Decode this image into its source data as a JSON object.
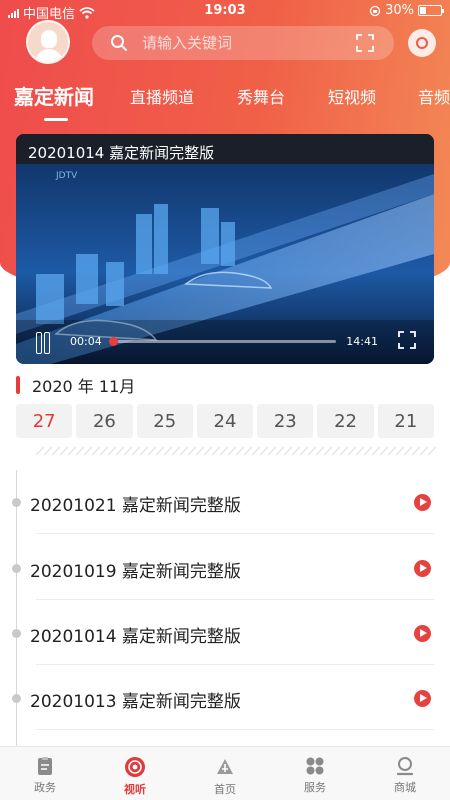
{
  "status_bar": {
    "carrier": "中国电信",
    "time": "19:03",
    "battery": "30%"
  },
  "search": {
    "placeholder": "请输入关键词"
  },
  "channel_tabs": [
    {
      "label": "嘉定新闻",
      "active": true
    },
    {
      "label": "直播频道"
    },
    {
      "label": "秀舞台"
    },
    {
      "label": "短视频"
    },
    {
      "label": "音频"
    }
  ],
  "player": {
    "title": "20201014 嘉定新闻完整版",
    "watermark": "JDTV",
    "current_time": "00:04",
    "duration": "14:41",
    "progress_fraction": 0.005
  },
  "date_header": "2020 年 11月",
  "days": [
    {
      "label": "27",
      "active": true
    },
    {
      "label": "26"
    },
    {
      "label": "25"
    },
    {
      "label": "24"
    },
    {
      "label": "23"
    },
    {
      "label": "22"
    },
    {
      "label": "21"
    }
  ],
  "episodes": [
    {
      "title": "20201021 嘉定新闻完整版"
    },
    {
      "title": "20201019 嘉定新闻完整版"
    },
    {
      "title": "20201014 嘉定新闻完整版"
    },
    {
      "title": "20201013 嘉定新闻完整版"
    }
  ],
  "bottom_nav": [
    {
      "label": "政务",
      "icon": "clipboard-icon"
    },
    {
      "label": "视听",
      "icon": "play-circle-icon",
      "active": true
    },
    {
      "label": "首页",
      "icon": "home-logo-icon"
    },
    {
      "label": "服务",
      "icon": "grid-icon"
    },
    {
      "label": "商城",
      "icon": "shop-icon"
    }
  ],
  "colors": {
    "brand_red": "#e63c3c",
    "header_gradient_start": "#ef4c4c",
    "header_gradient_end": "#f38a56"
  }
}
